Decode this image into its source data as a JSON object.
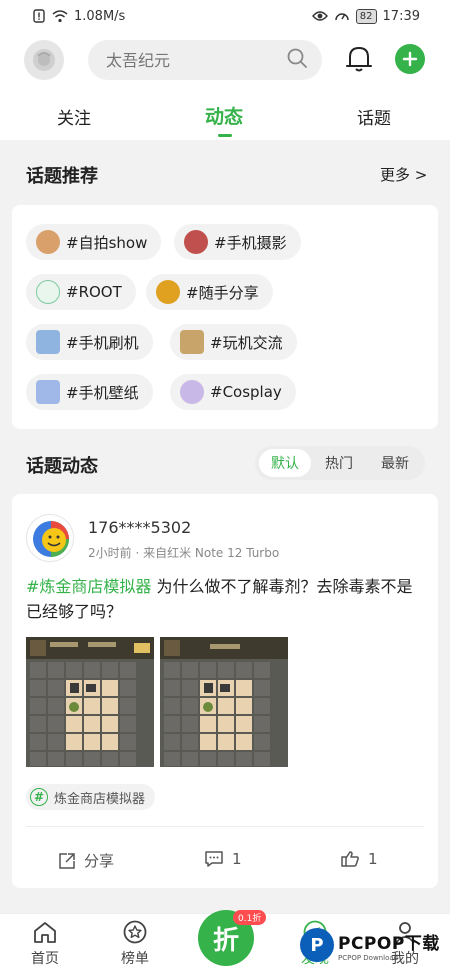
{
  "status_bar": {
    "speed": "1.08M/s",
    "battery": "82",
    "time": "17:39"
  },
  "header": {
    "search_placeholder": "太吾纪元",
    "tabs": [
      {
        "label": "关注",
        "active": false
      },
      {
        "label": "动态",
        "active": true
      },
      {
        "label": "话题",
        "active": false
      }
    ]
  },
  "topic_section": {
    "title": "话题推荐",
    "more": "更多 >",
    "chips": [
      {
        "label": "#自拍show",
        "color": "#d9a06b"
      },
      {
        "label": "#手机摄影",
        "color": "#c0504d"
      },
      {
        "label": "#ROOT",
        "color": "#7ec8a0"
      },
      {
        "label": "#随手分享",
        "color": "#e0a020"
      },
      {
        "label": "#手机刷机",
        "color": "#8fb4e0"
      },
      {
        "label": "#玩机交流",
        "color": "#c9a46a"
      },
      {
        "label": "#手机壁纸",
        "color": "#9fb8e8"
      },
      {
        "label": "#Cosplay",
        "color": "#c8b8e8"
      }
    ]
  },
  "feed_section": {
    "title": "话题动态",
    "filters": [
      {
        "label": "默认",
        "active": true
      },
      {
        "label": "热门",
        "active": false
      },
      {
        "label": "最新",
        "active": false
      }
    ]
  },
  "post": {
    "user": "176****5302",
    "meta": "2小时前 · 来自红米 Note 12 Turbo",
    "topic": "#炼金商店模拟器",
    "text": " 为什么做不了解毒剂？去除毒素不是已经够了吗？",
    "tag": "炼金商店模拟器",
    "share_label": "分享",
    "comments": "1",
    "likes": "1"
  },
  "bottom_nav": {
    "items": [
      {
        "label": "首页",
        "icon": "home-icon",
        "active": false
      },
      {
        "label": "榜单",
        "icon": "star-icon",
        "active": false
      },
      {
        "label": "发现",
        "icon": "discover-icon",
        "active": true
      },
      {
        "label": "我的",
        "icon": "profile-icon",
        "active": false
      }
    ],
    "center_label": "折",
    "center_badge": "0.1折"
  },
  "watermark": {
    "main": "PCPOP下载",
    "sub": "PCPOP Download"
  },
  "colors": {
    "accent": "#35b24a",
    "background": "#f2f2f2"
  }
}
